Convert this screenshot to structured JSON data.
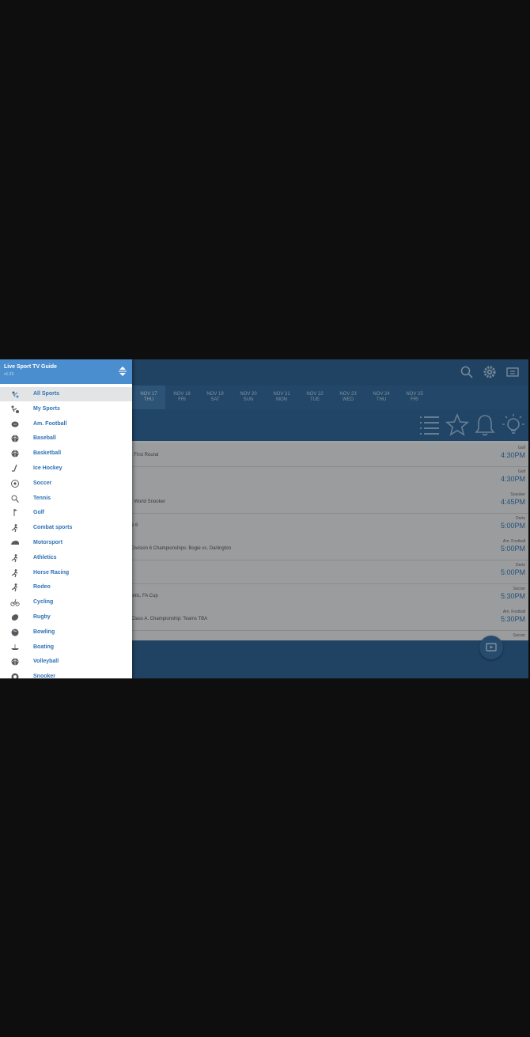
{
  "app": {
    "title": "Live Sport TV Guide",
    "version": "v1.23"
  },
  "colors": {
    "accent": "#2e72b5",
    "header": "#4a8ed0",
    "toolbar": "#2c5a85"
  },
  "top_icons": [
    "search-icon",
    "gear-icon",
    "tv-guide-icon"
  ],
  "dates": [
    {
      "date": "NOV 17",
      "day": "THU"
    },
    {
      "date": "NOV 18",
      "day": "FRI"
    },
    {
      "date": "NOV 19",
      "day": "SAT"
    },
    {
      "date": "NOV 20",
      "day": "SUN"
    },
    {
      "date": "NOV 21",
      "day": "MON"
    },
    {
      "date": "NOV 22",
      "day": "TUE"
    },
    {
      "date": "NOV 23",
      "day": "WED"
    },
    {
      "date": "NOV 24",
      "day": "THU"
    },
    {
      "date": "NOV 25",
      "day": "FRI"
    }
  ],
  "events": [
    {
      "title": ", First Round",
      "sport": "Golf",
      "time": "4:30PM"
    },
    {
      "title": "",
      "sport": "Golf",
      "time": "4:30PM"
    },
    {
      "title": ", World Snooker",
      "sport": "Snooker",
      "time": "4:45PM"
    },
    {
      "title": "e 6",
      "sport": "Darts",
      "time": "5:00PM"
    },
    {
      "title": "Division 6 Championships: Bogie vs. Darlington",
      "sport": "Am. Football",
      "time": "5:00PM"
    },
    {
      "title": "",
      "sport": "Darts",
      "time": "5:00PM"
    },
    {
      "title": "letic, FA Cup",
      "sport": "Soccer",
      "time": "5:30PM"
    },
    {
      "title": "Class A. Championship: Teams TBA",
      "sport": "Am. Football",
      "time": "5:30PM"
    },
    {
      "title": "",
      "sport": "Soccer",
      "time": ""
    }
  ],
  "menu": [
    {
      "label": "All Sports",
      "icon": "all-sports-icon",
      "selected": true
    },
    {
      "label": "My Sports",
      "icon": "my-sports-icon"
    },
    {
      "label": "Am. Football",
      "icon": "american-football-icon"
    },
    {
      "label": "Baseball",
      "icon": "baseball-icon"
    },
    {
      "label": "Basketball",
      "icon": "basketball-icon"
    },
    {
      "label": "Ice Hockey",
      "icon": "ice-hockey-icon"
    },
    {
      "label": "Soccer",
      "icon": "soccer-icon"
    },
    {
      "label": "Tennis",
      "icon": "tennis-icon"
    },
    {
      "label": "Golf",
      "icon": "golf-icon"
    },
    {
      "label": "Combat sports",
      "icon": "combat-sports-icon"
    },
    {
      "label": "Motorsport",
      "icon": "motorsport-icon"
    },
    {
      "label": "Athletics",
      "icon": "athletics-icon"
    },
    {
      "label": "Horse Racing",
      "icon": "horse-racing-icon"
    },
    {
      "label": "Rodeo",
      "icon": "rodeo-icon"
    },
    {
      "label": "Cycling",
      "icon": "cycling-icon"
    },
    {
      "label": "Rugby",
      "icon": "rugby-icon"
    },
    {
      "label": "Bowling",
      "icon": "bowling-icon"
    },
    {
      "label": "Boating",
      "icon": "boating-icon"
    },
    {
      "label": "Volleyball",
      "icon": "volleyball-icon"
    },
    {
      "label": "Snooker",
      "icon": "snooker-icon"
    }
  ]
}
